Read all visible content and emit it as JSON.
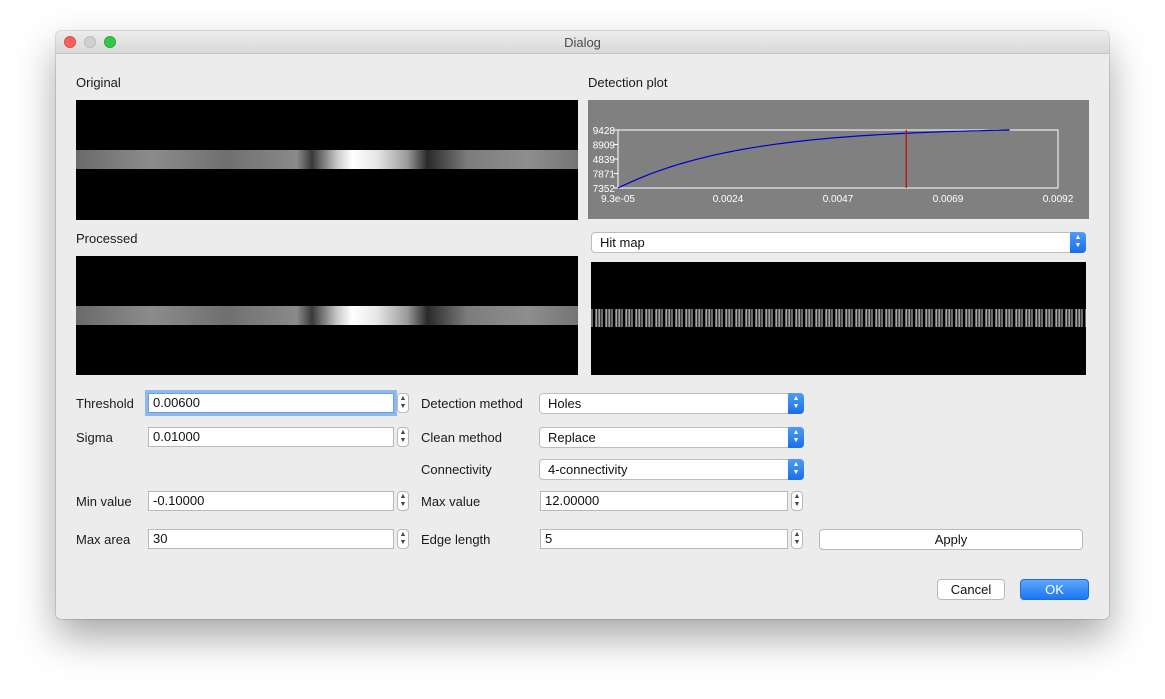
{
  "window": {
    "title": "Dialog"
  },
  "panels": {
    "original_label": "Original",
    "processed_label": "Processed",
    "plot_label": "Detection plot"
  },
  "detection_plot": {
    "y_ticks": [
      "9428",
      "8909",
      "4839",
      "7871",
      "7352"
    ],
    "x_ticks": [
      "9.3e-05",
      "0.0024",
      "0.0047",
      "0.0069",
      "0.0092"
    ],
    "marker_x_fraction": 0.655,
    "curve_color": "#0000cc",
    "marker_color": "#cc0000"
  },
  "view_select": {
    "value": "Hit map"
  },
  "form": {
    "threshold": {
      "label": "Threshold",
      "value": "0.00600"
    },
    "sigma": {
      "label": "Sigma",
      "value": "0.01000"
    },
    "min_value": {
      "label": "Min value",
      "value": "-0.10000"
    },
    "max_area": {
      "label": "Max area",
      "value": "30"
    },
    "detection_method": {
      "label": "Detection method",
      "value": "Holes"
    },
    "clean_method": {
      "label": "Clean method",
      "value": "Replace"
    },
    "connectivity": {
      "label": "Connectivity",
      "value": "4-connectivity"
    },
    "max_value": {
      "label": "Max value",
      "value": "12.00000"
    },
    "edge_length": {
      "label": "Edge length",
      "value": "5"
    }
  },
  "buttons": {
    "apply": "Apply",
    "cancel": "Cancel",
    "ok": "OK"
  },
  "colors": {
    "accent": "#1d76f2",
    "plot_bg": "#808080"
  }
}
